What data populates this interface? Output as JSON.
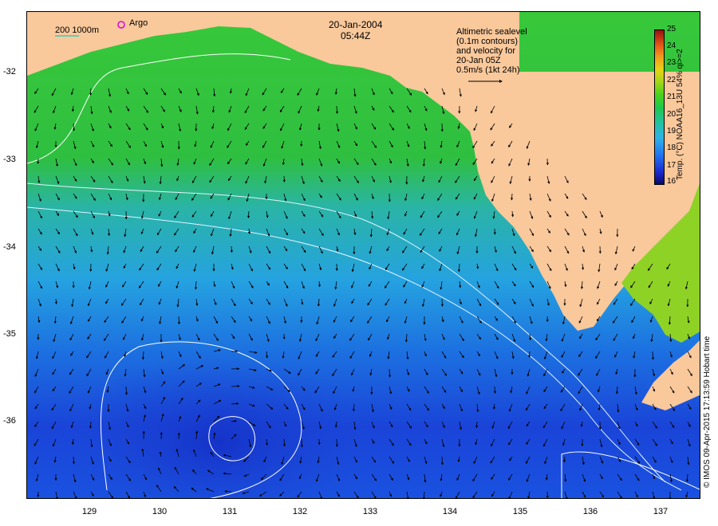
{
  "header": {
    "date": "20-Jan-2004",
    "time": "05:44Z"
  },
  "depth_legend": {
    "label": "200  1000m",
    "argo_label": "Argo"
  },
  "velocity_legend": {
    "lines": [
      "Altimetric sealevel",
      "(0.1m contours)",
      "and velocity for",
      "20-Jan 05Z",
      "0.5m/s (1kt 24h)"
    ]
  },
  "axes": {
    "y_ticks": [
      "-32",
      "-33",
      "-34",
      "-35",
      "-36"
    ],
    "x_ticks": [
      "129",
      "130",
      "131",
      "132",
      "133",
      "134",
      "135",
      "136",
      "137"
    ]
  },
  "colorbar": {
    "title": "Temp. (°C) NOAA16_13U 54% qi>=2",
    "ticks": [
      "25",
      "24",
      "23",
      "22",
      "21",
      "20",
      "19",
      "18",
      "17",
      "16"
    ],
    "colors": {
      "cold": "#0a0a6a",
      "cool": "#1f6ff0",
      "mid": "#1ec84a",
      "warm": "#e6d414",
      "hot": "#9a1010",
      "land": "#f9c89b"
    }
  },
  "credit": "© IMOS 09-Apr-2015 17:13:59 Hobart time"
}
